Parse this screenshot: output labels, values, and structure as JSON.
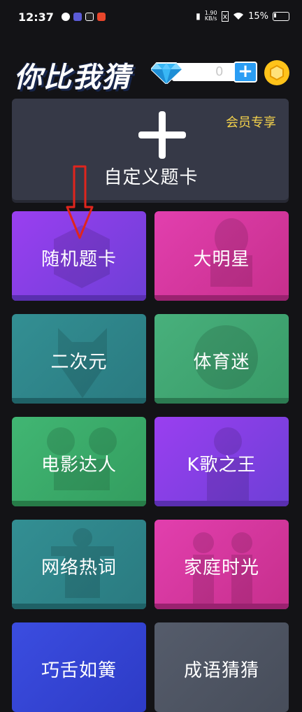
{
  "status_bar": {
    "time": "12:37",
    "net_speed_value": "1.90",
    "net_speed_unit": "KB/s",
    "battery": "15%"
  },
  "header": {
    "logo": "你比我猜",
    "gem_count": "0",
    "plus_label": "+"
  },
  "custom_card": {
    "label": "自定义题卡",
    "vip": "会员专享"
  },
  "categories": [
    {
      "label": "随机题卡",
      "color": "#8a3be0"
    },
    {
      "label": "大明星",
      "color": "#d2349b"
    },
    {
      "label": "二次元",
      "color": "#2f868a"
    },
    {
      "label": "体育迷",
      "color": "#3fa672"
    },
    {
      "label": "电影达人",
      "color": "#3aa866"
    },
    {
      "label": "K歌之王",
      "color": "#8a3be0"
    },
    {
      "label": "网络热词",
      "color": "#2f868a"
    },
    {
      "label": "家庭时光",
      "color": "#d2349b"
    },
    {
      "label": "巧舌如簧",
      "color": "#3b47d6"
    },
    {
      "label": "成语猜猜",
      "color": "#4a5160"
    }
  ]
}
